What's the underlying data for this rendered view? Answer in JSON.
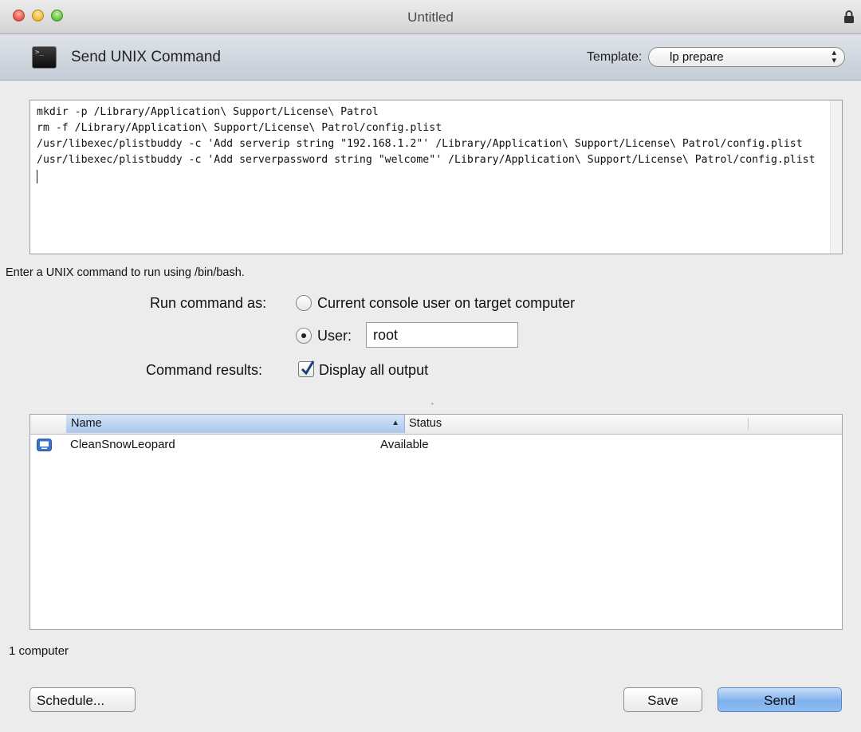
{
  "window": {
    "title": "Untitled"
  },
  "header": {
    "title": "Send UNIX Command",
    "template_label": "Template:",
    "template_value": "lp prepare"
  },
  "command": {
    "text": "mkdir -p /Library/Application\\ Support/License\\ Patrol\nrm -f /Library/Application\\ Support/License\\ Patrol/config.plist\n/usr/libexec/plistbuddy -c 'Add serverip string \"192.168.1.2\"' /Library/Application\\ Support/License\\ Patrol/config.plist\n/usr/libexec/plistbuddy -c 'Add serverpassword string \"welcome\"' /Library/Application\\ Support/License\\ Patrol/config.plist",
    "hint": "Enter a UNIX command to run using /bin/bash."
  },
  "run_as": {
    "label": "Run command as:",
    "option_console": "Current console user on target computer",
    "option_user": "User:",
    "selected": "user",
    "user_value": "root"
  },
  "results": {
    "label": "Command results:",
    "checkbox_label": "Display all output",
    "checked": true
  },
  "table": {
    "columns": [
      "Name",
      "Status"
    ],
    "sorted_column": "Name",
    "rows": [
      {
        "name": "CleanSnowLeopard",
        "status": "Available",
        "icon": "computer-icon"
      }
    ]
  },
  "footer": {
    "count_text": "1 computer",
    "schedule_label": "Schedule...",
    "save_label": "Save",
    "send_label": "Send"
  }
}
